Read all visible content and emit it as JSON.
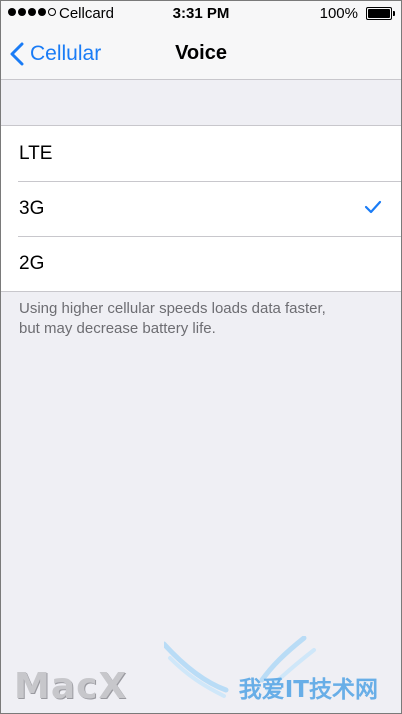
{
  "status_bar": {
    "carrier": "Cellcard",
    "time": "3:31 PM",
    "battery_percent": "100%",
    "signal_bars_filled": 4,
    "signal_bars_total": 5
  },
  "nav": {
    "back_label": "Cellular",
    "title": "Voice"
  },
  "options": [
    {
      "label": "LTE",
      "selected": false
    },
    {
      "label": "3G",
      "selected": true
    },
    {
      "label": "2G",
      "selected": false
    }
  ],
  "footer": {
    "note_line1": "Using higher cellular speeds loads data faster,",
    "note_line2": "but may decrease battery life."
  },
  "watermarks": {
    "left": "MacX",
    "right": "我爱IT技术网"
  },
  "colors": {
    "accent": "#1a7cf6",
    "background": "#efeff4",
    "separator": "#c8c7cc",
    "footer_text": "#6d6d72"
  }
}
